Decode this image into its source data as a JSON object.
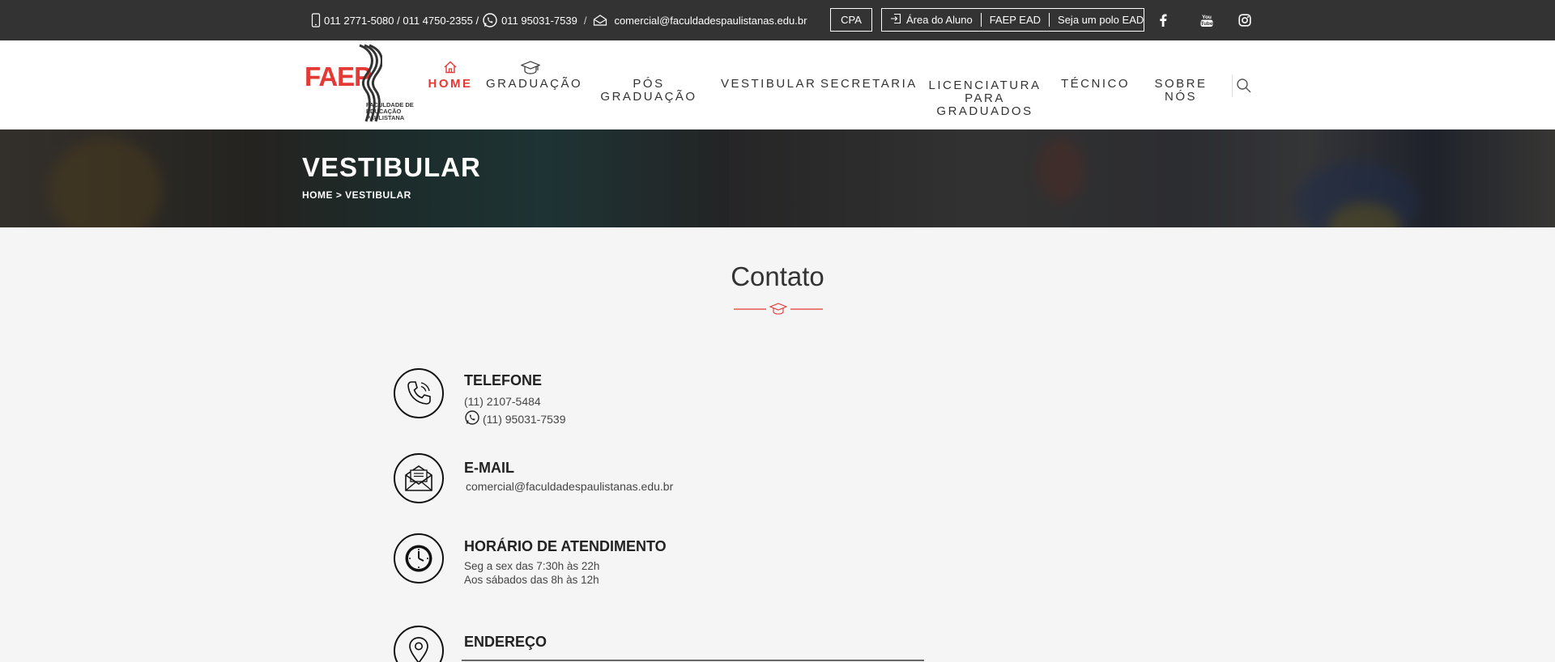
{
  "topbar": {
    "phone_numbers": "011 2771-5080 / 011 4750-2355 /",
    "whatsapp": "011 95031-7539",
    "email": "comercial@faculdadespaulistanas.edu.br",
    "cpa_label": "CPA",
    "links": [
      {
        "label": "Área do Aluno",
        "icon": "login-icon"
      },
      {
        "label": "FAEP EAD"
      },
      {
        "label": "Seja um polo EAD"
      }
    ],
    "social": [
      {
        "name": "facebook-icon"
      },
      {
        "name": "youtube-icon",
        "text": "You Tube"
      },
      {
        "name": "instagram-icon"
      }
    ]
  },
  "logo": {
    "brand": "FAEP",
    "subtitle_line1": "FACULDADE DE",
    "subtitle_line2": "EDUCAÇÃO",
    "subtitle_line3": "PAULISTANA",
    "brand_color": "#e53935"
  },
  "nav": {
    "items": [
      {
        "label": "HOME",
        "icon": "home-icon",
        "active": true
      },
      {
        "label": "GRADUAÇÃO",
        "icon": "graduation-cap-icon"
      },
      {
        "label": "PÓS GRADUAÇÃO"
      },
      {
        "label": "VESTIBULAR"
      },
      {
        "label": "SECRETARIA"
      },
      {
        "label_line1": "LICENCIATURA",
        "label_line2": "PARA GRADUADOS"
      },
      {
        "label": "TÉCNICO"
      },
      {
        "label": "SOBRE NÓS"
      }
    ],
    "search_icon": "search-icon"
  },
  "hero": {
    "title": "VESTIBULAR",
    "breadcrumb": "HOME > VESTIBULAR"
  },
  "contact": {
    "title": "Contato",
    "accent": "#e53935",
    "items": [
      {
        "heading": "TELEFONE",
        "icon": "phone-icon",
        "lines": [
          "(11) 2107-5484",
          "(11) 95031-7539"
        ]
      },
      {
        "heading": "E-MAIL",
        "icon": "email-icon",
        "lines": [
          "comercial@faculdadespaulistanas.edu.br"
        ]
      },
      {
        "heading": "HORÁRIO DE ATENDIMENTO",
        "icon": "clock-icon",
        "lines": [
          "Seg a sex das 7:30h às 22h",
          "Aos sábados das 8h às 12h"
        ]
      },
      {
        "heading": "ENDEREÇO",
        "icon": "map-pin-icon",
        "lines": []
      }
    ]
  }
}
